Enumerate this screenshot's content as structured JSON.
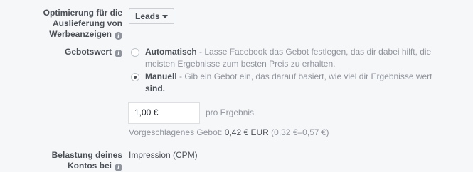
{
  "optimization": {
    "label_line1": "Optimierung für die",
    "label_line2": "Auslieferung von",
    "label_line3": "Werbeanzeigen",
    "dropdown_value": "Leads"
  },
  "bid": {
    "label": "Gebotswert",
    "options": [
      {
        "title": "Automatisch",
        "desc_line1": " - Lasse Facebook das Gebot festlegen, das dir dabei hilft, die",
        "desc_line2": "meisten Ergebnisse zum besten Preis zu erhalten.",
        "checked": false
      },
      {
        "title": "Manuell",
        "desc_line1": " - Gib ein Gebot ein, das darauf basiert, wie viel dir Ergebnisse wert",
        "desc_line2": "sind.",
        "checked": true
      }
    ],
    "input_value": "1,00 €",
    "input_suffix": "pro Ergebnis",
    "suggested_label": "Vorgeschlagenes Gebot: ",
    "suggested_value": "0,42 € EUR",
    "suggested_range": " (0,32 €–0,57 €)"
  },
  "billing": {
    "label_line1": "Belastung deines",
    "label_line2": "Kontos bei",
    "value": "Impression (CPM)"
  },
  "icons": {
    "info": "info-icon",
    "caret": "caret-down-icon"
  },
  "colors": {
    "background": "#f6f7f9",
    "text": "#4b4f56",
    "muted": "#90949c"
  }
}
